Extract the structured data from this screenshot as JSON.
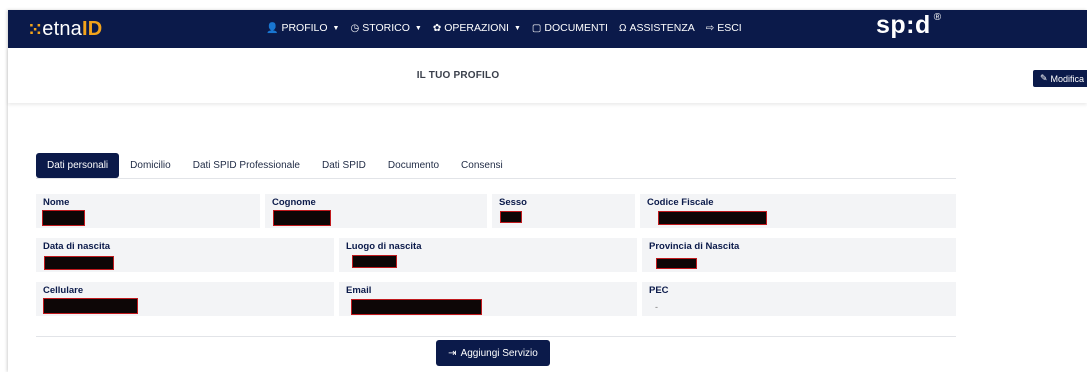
{
  "brand": {
    "logo_dots": "⁙",
    "logo_etna": "etna",
    "logo_id": "ID",
    "spid_logo": "sp:d",
    "spid_mark": "®"
  },
  "nav": {
    "items": [
      {
        "icon": "user-icon",
        "glyph": "👤",
        "label": "PROFILO",
        "dropdown": true
      },
      {
        "icon": "clock-icon",
        "glyph": "◷",
        "label": "STORICO",
        "dropdown": true
      },
      {
        "icon": "gear-icon",
        "glyph": "✿",
        "label": "OPERAZIONI",
        "dropdown": true
      },
      {
        "icon": "document-icon",
        "glyph": "▢",
        "label": "DOCUMENTI",
        "dropdown": false
      },
      {
        "icon": "headset-icon",
        "glyph": "Ω",
        "label": "ASSISTENZA",
        "dropdown": false
      },
      {
        "icon": "logout-icon",
        "glyph": "⇨",
        "label": "ESCI",
        "dropdown": false
      }
    ],
    "caret": "▼"
  },
  "header": {
    "title": "IL TUO PROFILO",
    "edit_label": "Modifica",
    "edit_icon": "✎"
  },
  "tabs": [
    {
      "label": "Dati personali",
      "active": true
    },
    {
      "label": "Domicilio",
      "active": false
    },
    {
      "label": "Dati SPID Professionale",
      "active": false
    },
    {
      "label": "Dati SPID",
      "active": false
    },
    {
      "label": "Documento",
      "active": false
    },
    {
      "label": "Consensi",
      "active": false
    }
  ],
  "fields": {
    "nome": {
      "label": "Nome",
      "redacted": true
    },
    "cognome": {
      "label": "Cognome",
      "redacted": true
    },
    "sesso": {
      "label": "Sesso",
      "redacted": true
    },
    "codice_fiscale": {
      "label": "Codice Fiscale",
      "redacted": true
    },
    "data_nascita": {
      "label": "Data di nascita",
      "redacted": true
    },
    "luogo_nascita": {
      "label": "Luogo di nascita",
      "redacted": true
    },
    "provincia_nascita": {
      "label": "Provincia di Nascita",
      "redacted": true
    },
    "cellulare": {
      "label": "Cellulare",
      "redacted": true
    },
    "email": {
      "label": "Email",
      "redacted": true
    },
    "pec": {
      "label": "PEC",
      "value": "-"
    }
  },
  "actions": {
    "add_service_label": "Aggiungi Servizio",
    "add_service_icon": "⇥"
  },
  "colors": {
    "navbar": "#0b1a4a",
    "accent": "#f2a31b",
    "redaction_border": "#c0191d",
    "field_bg": "#f3f4f6"
  }
}
